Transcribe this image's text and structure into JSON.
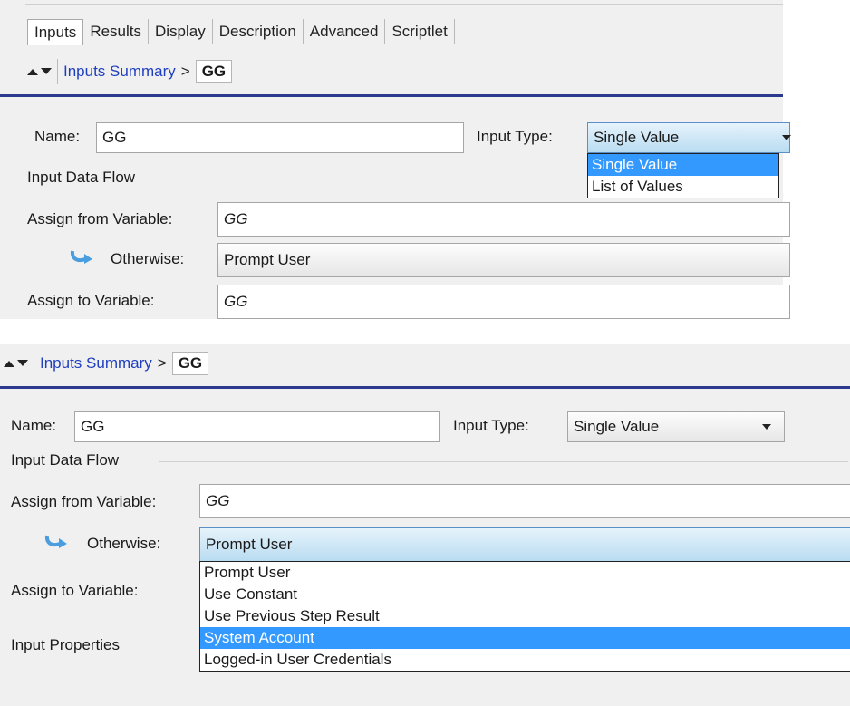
{
  "top": {
    "tabs": [
      "Inputs",
      "Results",
      "Display",
      "Description",
      "Advanced",
      "Scriptlet"
    ],
    "breadcrumb": {
      "link": "Inputs Summary",
      "separator": ">",
      "current": "GG"
    },
    "name_label": "Name:",
    "name_value": "GG",
    "input_type_label": "Input Type:",
    "input_type_value": "Single Value",
    "input_type_options": [
      "Single Value",
      "List of Values"
    ],
    "input_type_selected": "Single Value",
    "group_title": "Input Data Flow",
    "assign_from_label": "Assign from Variable:",
    "assign_from_value": "GG",
    "otherwise_label": "Otherwise:",
    "otherwise_value": "Prompt User",
    "assign_to_label": "Assign to Variable:",
    "assign_to_value": "GG"
  },
  "bottom": {
    "breadcrumb": {
      "link": "Inputs Summary",
      "separator": ">",
      "current": "GG"
    },
    "name_label": "Name:",
    "name_value": "GG",
    "input_type_label": "Input Type:",
    "input_type_value": "Single Value",
    "group_title": "Input Data Flow",
    "assign_from_label": "Assign from Variable:",
    "assign_from_value": "GG",
    "otherwise_label": "Otherwise:",
    "otherwise_value": "Prompt User",
    "assign_to_label": "Assign to Variable:",
    "input_properties_label": "Input Properties",
    "otherwise_options": [
      "Prompt User",
      "Use Constant",
      "Use Previous Step Result",
      "System Account",
      "Logged-in User Credentials"
    ],
    "otherwise_highlighted": "System Account"
  },
  "colors": {
    "accent_line": "#2b3a8f",
    "selection": "#3399ff",
    "link": "#1f3fbf"
  }
}
